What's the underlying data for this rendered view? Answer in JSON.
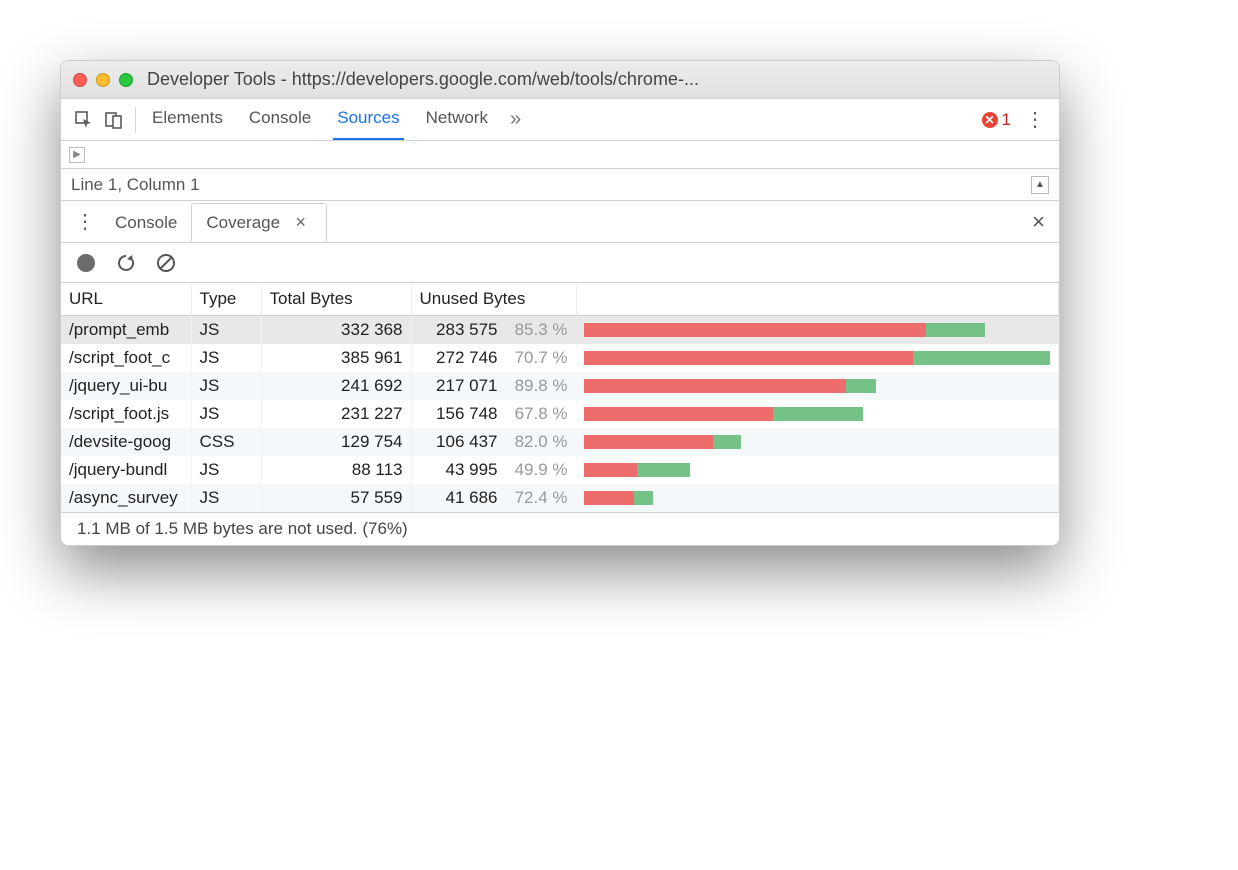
{
  "window": {
    "title": "Developer Tools - https://developers.google.com/web/tools/chrome-..."
  },
  "main_tabs": {
    "elements": "Elements",
    "console": "Console",
    "sources": "Sources",
    "network": "Network",
    "active": "sources"
  },
  "error_count": "1",
  "status_line": "Line 1, Column 1",
  "drawer": {
    "console": "Console",
    "coverage": "Coverage"
  },
  "table": {
    "headers": {
      "url": "URL",
      "type": "Type",
      "total": "Total Bytes",
      "unused": "Unused Bytes"
    },
    "max_total": 385961,
    "rows": [
      {
        "url": "/prompt_emb",
        "type": "JS",
        "total": "332 368",
        "unused": "283 575",
        "pct": "85.3 %",
        "total_n": 332368,
        "unused_n": 283575,
        "selected": true
      },
      {
        "url": "/script_foot_c",
        "type": "JS",
        "total": "385 961",
        "unused": "272 746",
        "pct": "70.7 %",
        "total_n": 385961,
        "unused_n": 272746
      },
      {
        "url": "/jquery_ui-bu",
        "type": "JS",
        "total": "241 692",
        "unused": "217 071",
        "pct": "89.8 %",
        "total_n": 241692,
        "unused_n": 217071
      },
      {
        "url": "/script_foot.js",
        "type": "JS",
        "total": "231 227",
        "unused": "156 748",
        "pct": "67.8 %",
        "total_n": 231227,
        "unused_n": 156748
      },
      {
        "url": "/devsite-goog",
        "type": "CSS",
        "total": "129 754",
        "unused": "106 437",
        "pct": "82.0 %",
        "total_n": 129754,
        "unused_n": 106437
      },
      {
        "url": "/jquery-bundl",
        "type": "JS",
        "total": "88 113",
        "unused": "43 995",
        "pct": "49.9 %",
        "total_n": 88113,
        "unused_n": 43995
      },
      {
        "url": "/async_survey",
        "type": "JS",
        "total": "57 559",
        "unused": "41 686",
        "pct": "72.4 %",
        "total_n": 57559,
        "unused_n": 41686
      }
    ]
  },
  "footer": "1.1 MB of 1.5 MB bytes are not used. (76%)"
}
